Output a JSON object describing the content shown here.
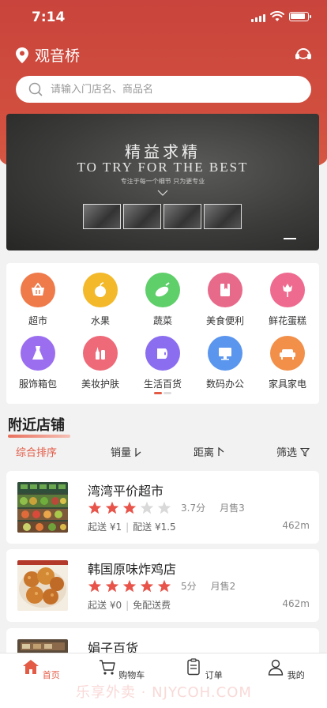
{
  "status": {
    "time": "7:14"
  },
  "location": {
    "name": "观音桥"
  },
  "search": {
    "placeholder": "请输入门店名、商品名"
  },
  "banner": {
    "title_cn": "精益求精",
    "title_en": "TO TRY FOR THE BEST",
    "subtitle": "专注于每一个细节 只为更专业"
  },
  "categories": [
    {
      "label": "超市",
      "icon": "basket-icon",
      "color": "#ef7a4a"
    },
    {
      "label": "水果",
      "icon": "apple-icon",
      "color": "#f3b92a"
    },
    {
      "label": "蔬菜",
      "icon": "eggplant-icon",
      "color": "#5fcf6a"
    },
    {
      "label": "美食便利",
      "icon": "bookmark-icon",
      "color": "#e86a8a"
    },
    {
      "label": "鲜花蛋糕",
      "icon": "tulip-icon",
      "color": "#ee6a8f"
    },
    {
      "label": "服饰箱包",
      "icon": "dress-icon",
      "color": "#9b6ef0"
    },
    {
      "label": "美妆护肤",
      "icon": "cosmetics-icon",
      "color": "#ee6a78"
    },
    {
      "label": "生活百货",
      "icon": "toilet-paper-icon",
      "color": "#8b6ef0"
    },
    {
      "label": "数码办公",
      "icon": "monitor-icon",
      "color": "#5a95ee"
    },
    {
      "label": "家具家电",
      "icon": "sofa-icon",
      "color": "#f2904a"
    }
  ],
  "nearby": {
    "title": "附近店铺",
    "sort": {
      "default": "综合排序",
      "sales": "销量",
      "distance": "距离",
      "filter": "筛选"
    },
    "stores": [
      {
        "name": "湾湾平价超市",
        "rating": 3,
        "score": "3.7分",
        "sold": "月售3",
        "min_order": "起送 ¥1",
        "delivery_fee": "配送 ¥1.5",
        "distance": "462m"
      },
      {
        "name": "韩国原味炸鸡店",
        "rating": 5,
        "score": "5分",
        "sold": "月售2",
        "min_order": "起送 ¥0",
        "delivery_fee": "免配送费",
        "distance": "462m"
      },
      {
        "name": "娟子百货"
      }
    ]
  },
  "tabs": [
    {
      "label": "首页",
      "icon": "home-icon",
      "active": true
    },
    {
      "label": "购物车",
      "icon": "cart-icon"
    },
    {
      "label": "订单",
      "icon": "order-icon"
    },
    {
      "label": "我的",
      "icon": "user-icon"
    }
  ],
  "watermark": "乐享外卖 · NJYCOH.COM",
  "colors": {
    "brand": "#d04a3e",
    "accent": "#e35a45",
    "star_on": "#e8544a",
    "star_off": "#d9d9d9"
  }
}
